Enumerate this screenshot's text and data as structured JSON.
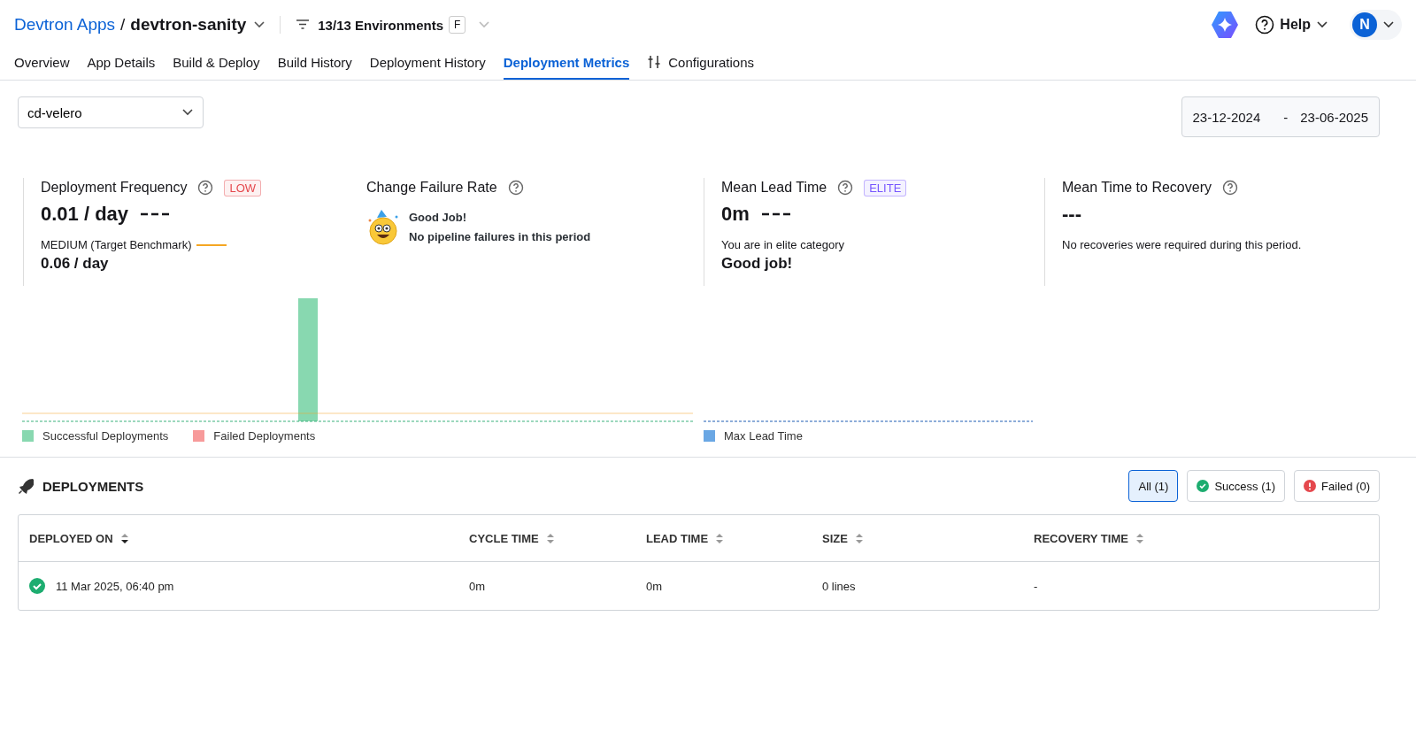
{
  "header": {
    "breadcrumb": "Devtron Apps",
    "separator": "/",
    "app_name": "devtron-sanity",
    "environments": "13/13 Environments",
    "env_badge": "F",
    "help": "Help",
    "avatar": "N"
  },
  "tabs": [
    {
      "label": "Overview",
      "selected": false,
      "kind": "plain"
    },
    {
      "label": "App Details",
      "selected": false,
      "kind": "plain"
    },
    {
      "label": "Build & Deploy",
      "selected": false,
      "kind": "plain"
    },
    {
      "label": "Build History",
      "selected": false,
      "kind": "plain"
    },
    {
      "label": "Deployment History",
      "selected": false,
      "kind": "plain"
    },
    {
      "label": "Deployment Metrics",
      "selected": true,
      "kind": "plain"
    },
    {
      "label": "Configurations",
      "selected": false,
      "kind": "sliders"
    }
  ],
  "pipeline_select": {
    "value": "cd-velero"
  },
  "date_range": {
    "start": "23-12-2024",
    "separator": "-",
    "end": "23-06-2025"
  },
  "metrics": [
    {
      "kind": "stat",
      "title": "Deployment Frequency",
      "badge": {
        "text": "LOW",
        "color": "#e5484d"
      },
      "value": "0.01 / day",
      "trend_line": true,
      "benchmark_label": "MEDIUM (Target Benchmark)",
      "benchmark_value": "0.06 / day"
    },
    {
      "kind": "message",
      "title": "Change Failure Rate",
      "message_title": "Good Job!",
      "message": "No pipeline failures in this period"
    },
    {
      "kind": "stat",
      "title": "Mean Lead Time",
      "badge": {
        "text": "ELITE",
        "color": "#7856ff"
      },
      "value": "0m",
      "trend_line": true,
      "note": "You are in elite category",
      "note_strong": "Good job!"
    },
    {
      "kind": "stat",
      "title": "Mean Time to Recovery",
      "value": "---",
      "note": "No recoveries were required during this period."
    }
  ],
  "charts": [
    {
      "legend": [
        {
          "label": "Successful Deployments",
          "color": "#88d8b0"
        },
        {
          "label": "Failed Deployments",
          "color": "#f79a9a"
        }
      ]
    },
    {
      "legend": [
        {
          "label": "Max Lead Time",
          "color": "#6aa7e4"
        }
      ]
    }
  ],
  "deployments": {
    "title": "DEPLOYMENTS",
    "filters": [
      {
        "label": "All (1)",
        "selected": true,
        "kind": "all"
      },
      {
        "label": "Success (1)",
        "selected": false,
        "kind": "success"
      },
      {
        "label": "Failed (0)",
        "selected": false,
        "kind": "failed"
      }
    ],
    "columns": [
      {
        "label": "DEPLOYED ON",
        "sorted": true
      },
      {
        "label": "CYCLE TIME",
        "sorted": false
      },
      {
        "label": "LEAD TIME",
        "sorted": false
      },
      {
        "label": "SIZE",
        "sorted": false
      },
      {
        "label": "RECOVERY TIME",
        "sorted": false
      }
    ],
    "rows": [
      {
        "kind": "success",
        "cells": [
          "11 Mar 2025, 06:40 pm",
          "0m",
          "0m",
          "0 lines",
          "-"
        ]
      }
    ]
  }
}
